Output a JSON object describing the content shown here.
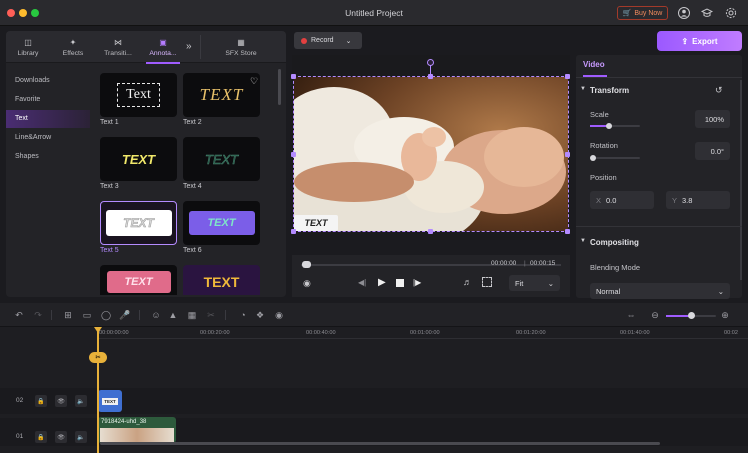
{
  "window": {
    "title": "Untitled Project",
    "buy_now": "Buy Now"
  },
  "toolbar_icons": [
    "avatar-icon",
    "graduation-cap-icon",
    "settings-icon"
  ],
  "media_tabs": [
    {
      "label": "Library",
      "icon": "library-icon"
    },
    {
      "label": "Effects",
      "icon": "effects-icon"
    },
    {
      "label": "Transiti...",
      "icon": "transition-icon"
    },
    {
      "label": "Annota...",
      "icon": "annotation-icon",
      "active": true
    },
    {
      "label": "SFX Store",
      "icon": "store-icon"
    }
  ],
  "sidebar": {
    "items": [
      {
        "label": "Downloads"
      },
      {
        "label": "Favorite"
      },
      {
        "label": "Text",
        "active": true
      },
      {
        "label": "Line&Arrow"
      },
      {
        "label": "Shapes"
      }
    ]
  },
  "text_presets": [
    {
      "label": "Text 1",
      "style": "TEXT"
    },
    {
      "label": "Text 2",
      "style": "TEXT"
    },
    {
      "label": "Text 3",
      "style": "TEXT"
    },
    {
      "label": "Text 4",
      "style": "TEXT"
    },
    {
      "label": "Text 5",
      "style": "TEXT",
      "selected": true
    },
    {
      "label": "Text 6",
      "style": "TEXT"
    },
    {
      "label": "",
      "style": "TEXT"
    },
    {
      "label": "",
      "style": "TEXT"
    }
  ],
  "card_text": {
    "t1": "Text",
    "t2": "TEXT"
  },
  "preview": {
    "record_label": "Record",
    "overlay_text": "TEXT",
    "time_current": "00:00:00",
    "time_total": "00:00:15",
    "fit_label": "Fit"
  },
  "export_label": "Export",
  "properties": {
    "tab": "Video",
    "transform_title": "Transform",
    "scale_label": "Scale",
    "scale_value": "100%",
    "rotation_label": "Rotation",
    "rotation_value": "0.0°",
    "position_label": "Position",
    "x_label": "X",
    "x_value": "0.0",
    "y_label": "Y",
    "y_value": "3.8",
    "compositing_title": "Compositing",
    "blending_label": "Blending Mode",
    "blending_value": "Normal"
  },
  "timeline": {
    "ruler": [
      "00:00:00:00",
      "00:00:20:00",
      "00:00:40:00",
      "00:01:00:00",
      "00:01:20:00",
      "00:01:40:00",
      "00:02"
    ],
    "tracks": [
      {
        "number": "02",
        "clip": "TEXT"
      },
      {
        "number": "01",
        "clip": "7918424-uhd_38"
      }
    ]
  },
  "colors": {
    "accent": "#a05cff",
    "playhead": "#e8b13a",
    "record": "#e34040"
  }
}
